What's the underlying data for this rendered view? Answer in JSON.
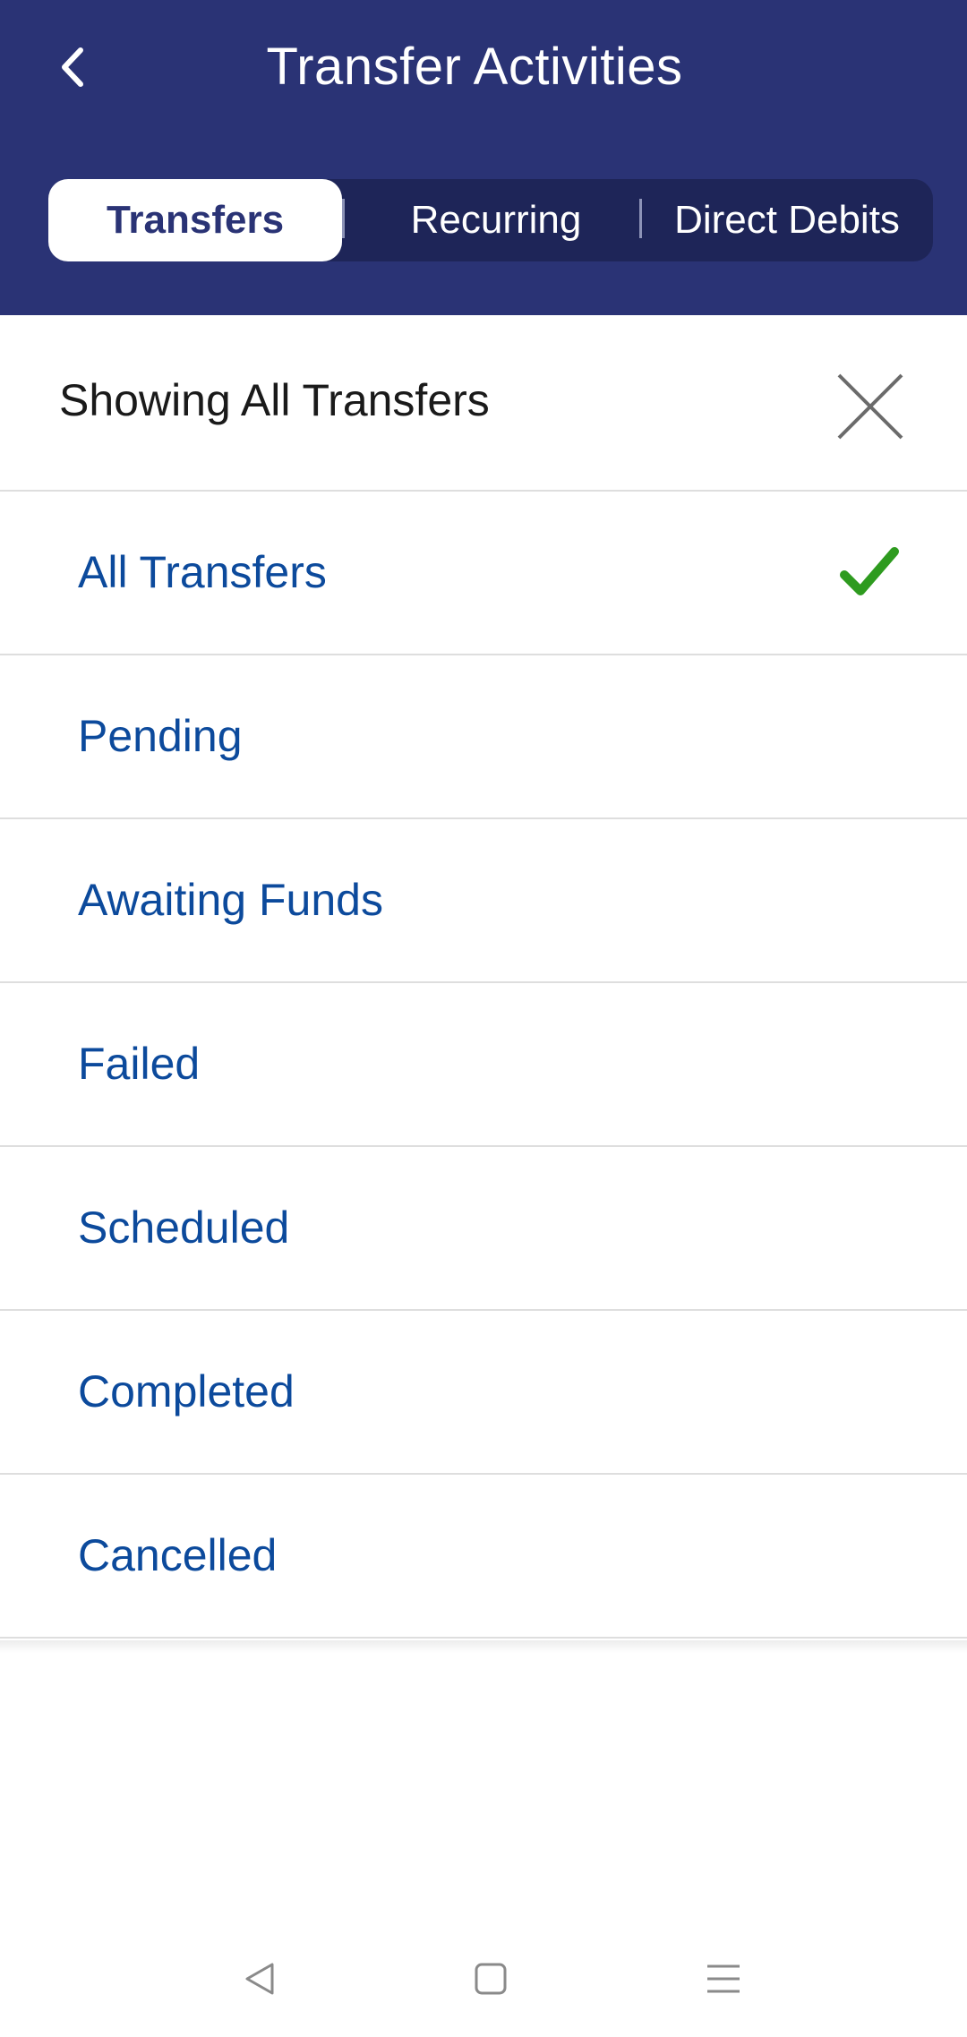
{
  "header": {
    "title": "Transfer Activities"
  },
  "tabs": [
    {
      "label": "Transfers",
      "active": true
    },
    {
      "label": "Recurring",
      "active": false
    },
    {
      "label": "Direct Debits",
      "active": false
    }
  ],
  "filter": {
    "title": "Showing All Transfers",
    "options": [
      {
        "label": "All Transfers",
        "selected": true
      },
      {
        "label": "Pending",
        "selected": false
      },
      {
        "label": "Awaiting Funds",
        "selected": false
      },
      {
        "label": "Failed",
        "selected": false
      },
      {
        "label": "Scheduled",
        "selected": false
      },
      {
        "label": "Completed",
        "selected": false
      },
      {
        "label": "Cancelled",
        "selected": false
      }
    ]
  },
  "icons": {
    "back": "chevron-left-icon",
    "close": "close-icon",
    "check": "checkmark-icon",
    "nav_back": "triangle-back-icon",
    "nav_home": "square-home-icon",
    "nav_menu": "menu-lines-icon"
  },
  "colors": {
    "header_bg": "#2a3375",
    "tab_track": "#1e2558",
    "option_text": "#0c4a9c",
    "check": "#2e9b1f"
  }
}
